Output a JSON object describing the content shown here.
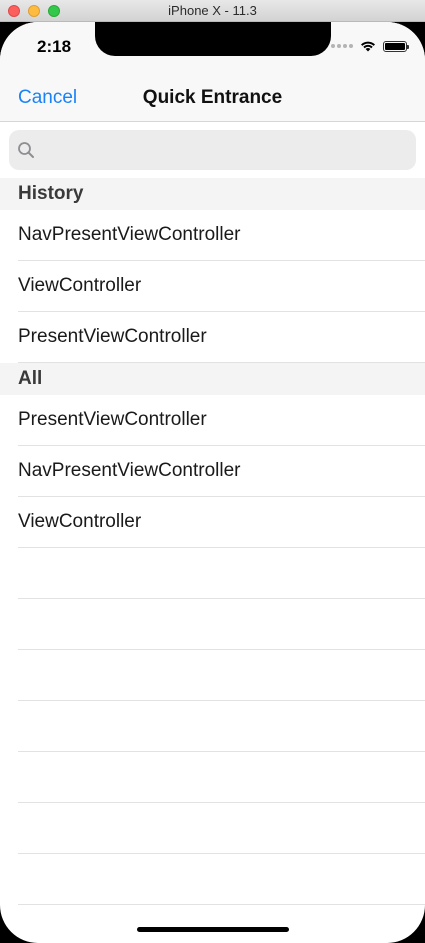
{
  "window": {
    "title": "iPhone X - 11.3"
  },
  "status_bar": {
    "time": "2:18",
    "icons": [
      "signal-icon",
      "wifi-icon",
      "battery-icon"
    ]
  },
  "nav": {
    "cancel_label": "Cancel",
    "title": "Quick Entrance"
  },
  "search": {
    "placeholder": "",
    "value": ""
  },
  "sections": [
    {
      "header": "History",
      "items": [
        "NavPresentViewController",
        "ViewController",
        "PresentViewController"
      ]
    },
    {
      "header": "All",
      "items": [
        "PresentViewController",
        "NavPresentViewController",
        "ViewController"
      ]
    }
  ],
  "colors": {
    "accent": "#1a82f7",
    "section_bg": "#f4f4f4",
    "separator": "#e2e2e2"
  }
}
